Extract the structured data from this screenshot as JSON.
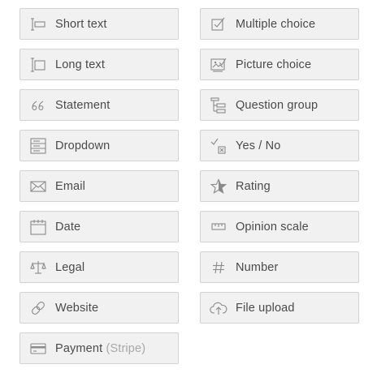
{
  "blocks": [
    {
      "label": "Short text",
      "icon": "short-text-icon"
    },
    {
      "label": "Multiple choice",
      "icon": "multiple-choice-icon"
    },
    {
      "label": "Long text",
      "icon": "long-text-icon"
    },
    {
      "label": "Picture choice",
      "icon": "picture-choice-icon"
    },
    {
      "label": "Statement",
      "icon": "quote-icon"
    },
    {
      "label": "Question group",
      "icon": "question-group-icon"
    },
    {
      "label": "Dropdown",
      "icon": "dropdown-icon"
    },
    {
      "label": "Yes / No",
      "icon": "yes-no-icon"
    },
    {
      "label": "Email",
      "icon": "envelope-icon"
    },
    {
      "label": "Rating",
      "icon": "star-icon"
    },
    {
      "label": "Date",
      "icon": "calendar-icon"
    },
    {
      "label": "Opinion scale",
      "icon": "ruler-icon"
    },
    {
      "label": "Legal",
      "icon": "scales-icon"
    },
    {
      "label": "Number",
      "icon": "hash-icon"
    },
    {
      "label": "Website",
      "icon": "link-icon"
    },
    {
      "label": "File upload",
      "icon": "cloud-upload-icon"
    },
    {
      "label": "Payment",
      "sublabel": "(Stripe)",
      "icon": "credit-card-icon"
    }
  ],
  "colors": {
    "tile_background": "#f1f1f1",
    "tile_border": "#d2d2d2",
    "label_text": "#4a4a4a",
    "sublabel_text": "#a8a8a8",
    "icon": "#8a8a8a"
  }
}
